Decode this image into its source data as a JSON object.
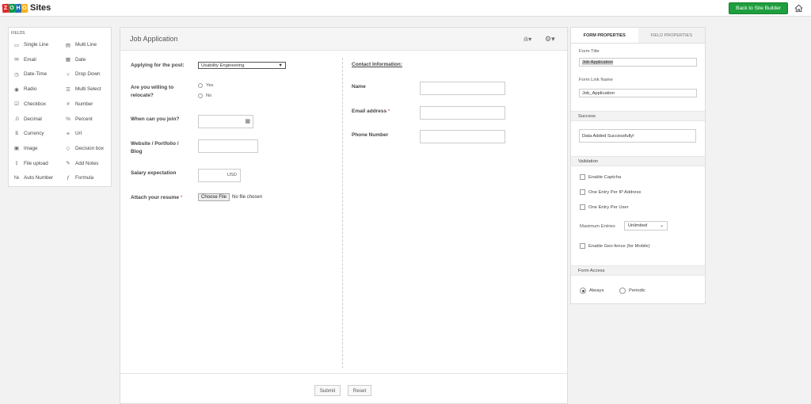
{
  "topbar": {
    "logo_letters": [
      "Z",
      "O",
      "H",
      "O"
    ],
    "logo_text": "Sites",
    "back_label": "Back to Site Builder"
  },
  "fields_panel": {
    "title": "FIELDS",
    "items": [
      {
        "label": "Single Line",
        "icon": "single-line-icon",
        "glyph": "▭"
      },
      {
        "label": "Multi Line",
        "icon": "multi-line-icon",
        "glyph": "▤"
      },
      {
        "label": "Email",
        "icon": "email-icon",
        "glyph": "✉"
      },
      {
        "label": "Date",
        "icon": "date-icon",
        "glyph": "▦"
      },
      {
        "label": "Date-Time",
        "icon": "date-time-icon",
        "glyph": "◷"
      },
      {
        "label": "Drop Down",
        "icon": "drop-down-icon",
        "glyph": "▿"
      },
      {
        "label": "Radio",
        "icon": "radio-icon",
        "glyph": "◉"
      },
      {
        "label": "Multi Select",
        "icon": "multi-select-icon",
        "glyph": "☰"
      },
      {
        "label": "Checkbox",
        "icon": "checkbox-icon",
        "glyph": "☑"
      },
      {
        "label": "Number",
        "icon": "number-icon",
        "glyph": "#"
      },
      {
        "label": "Decimal",
        "icon": "decimal-icon",
        "glyph": ".0"
      },
      {
        "label": "Percent",
        "icon": "percent-icon",
        "glyph": "%"
      },
      {
        "label": "Currency",
        "icon": "currency-icon",
        "glyph": "$"
      },
      {
        "label": "Url",
        "icon": "url-icon",
        "glyph": "⚭"
      },
      {
        "label": "Image",
        "icon": "image-icon",
        "glyph": "▣"
      },
      {
        "label": "Decision box",
        "icon": "decision-box-icon",
        "glyph": "◇"
      },
      {
        "label": "File upload",
        "icon": "file-upload-icon",
        "glyph": "⇪"
      },
      {
        "label": "Add Notes",
        "icon": "add-notes-icon",
        "glyph": "✎"
      },
      {
        "label": "Auto Number",
        "icon": "auto-number-icon",
        "glyph": "№"
      },
      {
        "label": "Formula",
        "icon": "formula-icon",
        "glyph": "ƒ"
      }
    ]
  },
  "form": {
    "title": "Job Application",
    "post_label": "Applying for the post:",
    "post_value": "Usability Engineering",
    "relocate_label_1": "Are you willing to",
    "relocate_label_2": "relocate?",
    "relocate_yes": "Yes",
    "relocate_no": "No",
    "join_label": "When can you join?",
    "website_label_1": "Website / Portfolio /",
    "website_label_2": "Blog",
    "salary_label": "Salary expectation",
    "salary_unit": "USD",
    "resume_label": "Attach your resume",
    "required_mark": "*",
    "choose_file": "Choose File",
    "no_file": "No file chosen",
    "contact_title": "Contact Information:",
    "name_label": "Name",
    "email_label": "Email address",
    "phone_label": "Phone Number",
    "submit": "Submit",
    "reset": "Reset"
  },
  "props": {
    "tab_form": "FORM PROPERTIES",
    "tab_field": "FIELD PROPERTIES",
    "form_title_label": "Form Title",
    "form_title_value": "Job Application",
    "link_name_label": "Form Link Name",
    "link_name_value": "Job_Application",
    "success_section": "Success",
    "success_message": "Data Added Successfully!",
    "validation_section": "Validation",
    "enable_captcha": "Enable Captcha",
    "one_per_ip": "One Entry Per IP Address",
    "one_per_user": "One Entry Per User",
    "max_entries_label": "Maximum Entries",
    "max_entries_value": "Unlimited",
    "geofence": "Enable Geo-fence (for Mobile)",
    "access_section": "Form Access",
    "access_always": "Always",
    "access_periodic": "Periodic"
  }
}
